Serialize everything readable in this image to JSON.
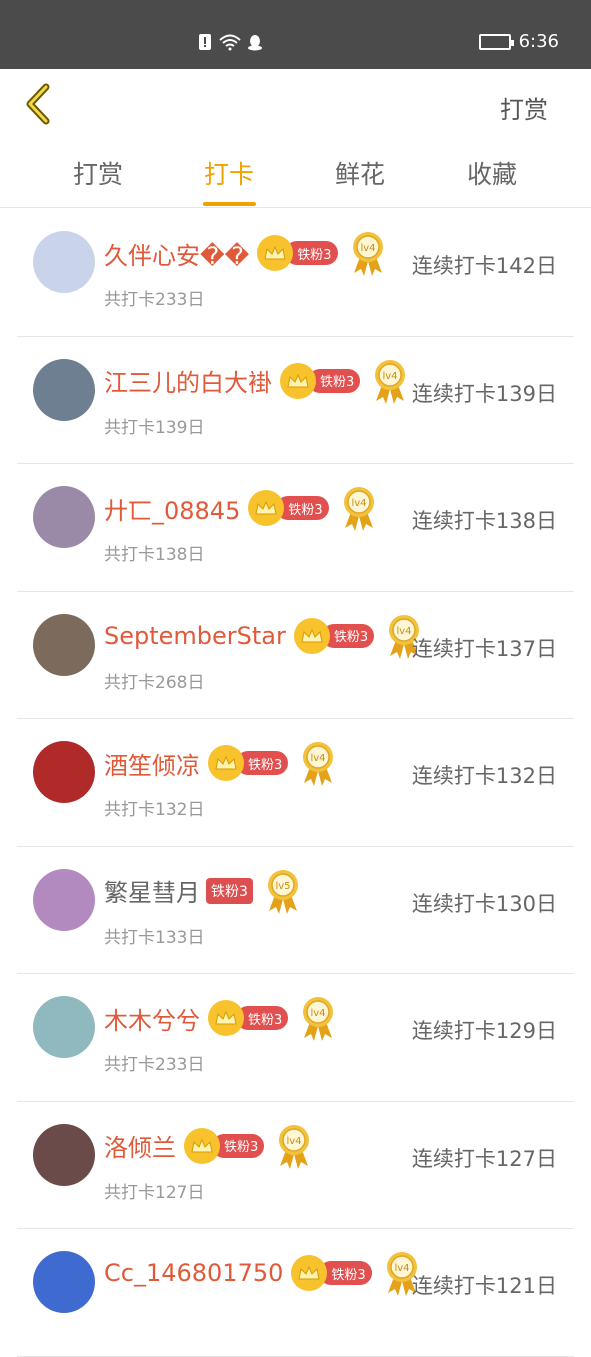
{
  "status_bar": {
    "time": "6:36"
  },
  "header": {
    "right_label": "打赏"
  },
  "tabs": [
    {
      "label": "打赏"
    },
    {
      "label": "打卡"
    },
    {
      "label": "鲜花"
    },
    {
      "label": "收藏"
    }
  ],
  "active_tab": "打卡",
  "colors": {
    "accent": "#f0a300",
    "name": "#e05a3a",
    "badge": "#e24f4f",
    "crown": "#f8c22c"
  },
  "items": [
    {
      "name": "久伴心安��",
      "fan": "铁粉3",
      "level": "lv4",
      "total": "共打卡233日",
      "streak": "连续打卡142日",
      "avatar_color": "#c9d3ea"
    },
    {
      "name": "江三儿的白大褂",
      "fan": "铁粉3",
      "level": "lv4",
      "total": "共打卡139日",
      "streak": "连续打卡139日",
      "avatar_color": "#6f7f92"
    },
    {
      "name": "廾匸_08845",
      "fan": "铁粉3",
      "level": "lv4",
      "total": "共打卡138日",
      "streak": "连续打卡138日",
      "avatar_color": "#9a8aa8"
    },
    {
      "name": "SeptemberStar",
      "fan": "铁粉3",
      "level": "lv4",
      "total": "共打卡268日",
      "streak": "连续打卡137日",
      "avatar_color": "#7c6a5c"
    },
    {
      "name": "酒笙倾凉",
      "fan": "铁粉3",
      "level": "lv4",
      "total": "共打卡132日",
      "streak": "连续打卡132日",
      "avatar_color": "#b02a2a"
    },
    {
      "name": "繁星彗月",
      "fan": "铁粉3",
      "level": "lv5",
      "total": "共打卡133日",
      "streak": "连续打卡130日",
      "avatar_color": "#b28ac0"
    },
    {
      "name": "木木兮兮",
      "fan": "铁粉3",
      "level": "lv4",
      "total": "共打卡233日",
      "streak": "连续打卡129日",
      "avatar_color": "#8fb9bf"
    },
    {
      "name": "洛倾兰",
      "fan": "铁粉3",
      "level": "lv4",
      "total": "共打卡127日",
      "streak": "连续打卡127日",
      "avatar_color": "#6b4a4a"
    },
    {
      "name": "Cc_146801750",
      "fan": "铁粉3",
      "level": "lv4",
      "total": "",
      "streak": "连续打卡121日",
      "avatar_color": "#3f6bd1"
    }
  ]
}
